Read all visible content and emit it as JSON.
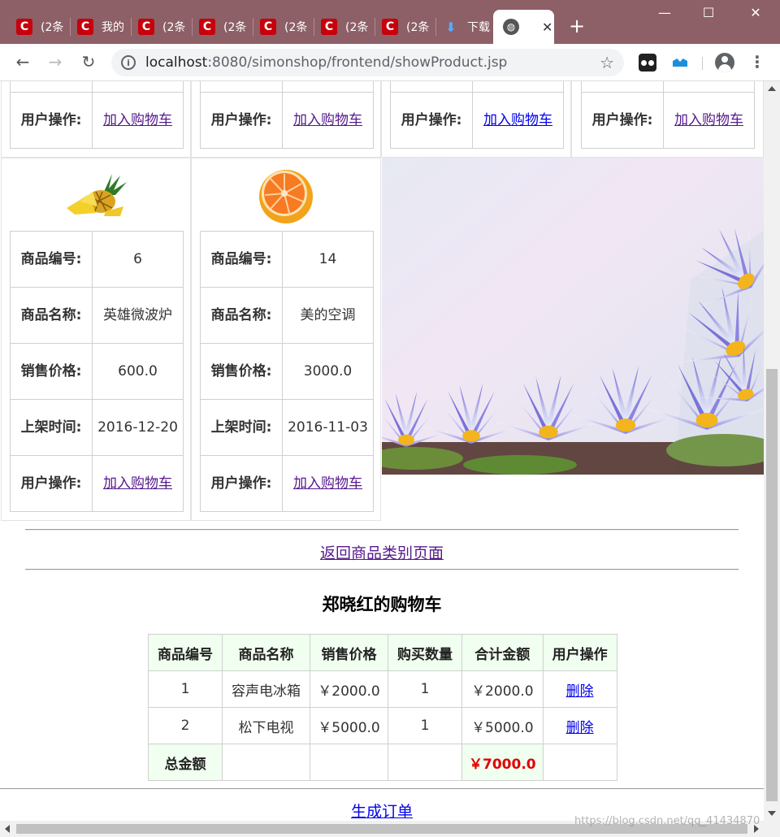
{
  "browser": {
    "tabs": [
      {
        "icon": "csdn-icon",
        "label": "(2条"
      },
      {
        "icon": "csdn-icon",
        "label": "我的"
      },
      {
        "icon": "csdn-icon",
        "label": "(2条"
      },
      {
        "icon": "csdn-icon",
        "label": "(2条"
      },
      {
        "icon": "csdn-icon",
        "label": "(2条"
      },
      {
        "icon": "csdn-icon",
        "label": "(2条"
      },
      {
        "icon": "csdn-icon",
        "label": "(2条"
      },
      {
        "icon": "download-icon",
        "label": "下载"
      }
    ],
    "active_tab": {
      "icon": "globe-icon",
      "close": "✕"
    },
    "new_tab": "+",
    "url_host": "localhost",
    "url_path": ":8080/simonshop/frontend/showProduct.jsp",
    "window": {
      "minimize": "—",
      "maximize": "☐",
      "close": "✕"
    }
  },
  "labels": {
    "id": "商品编号:",
    "name": "商品名称:",
    "price": "销售价格:",
    "date": "上架时间:",
    "action": "用户操作:",
    "add_cart": "加入购物车"
  },
  "top_row_cards": [
    {
      "action_label": "用户操作:",
      "link": "加入购物车"
    },
    {
      "action_label": "用户操作:",
      "link": "加入购物车"
    },
    {
      "action_label": "用户操作:",
      "link": "加入购物车"
    },
    {
      "action_label": "用户操作:",
      "link": "加入购物车"
    }
  ],
  "products": [
    {
      "image": "pineapple",
      "id": "6",
      "name": "英雄微波炉",
      "price": "600.0",
      "date": "2016-12-20"
    },
    {
      "image": "orange",
      "id": "14",
      "name": "美的空调",
      "price": "3000.0",
      "date": "2016-11-03"
    }
  ],
  "back_link": "返回商品类别页面",
  "cart": {
    "title": "郑晓红的购物车",
    "headers": [
      "商品编号",
      "商品名称",
      "销售价格",
      "购买数量",
      "合计金额",
      "用户操作"
    ],
    "rows": [
      {
        "id": "1",
        "name": "容声电冰箱",
        "price": "￥2000.0",
        "qty": "1",
        "subtotal": "￥2000.0",
        "action": "删除"
      },
      {
        "id": "2",
        "name": "松下电视",
        "price": "￥5000.0",
        "qty": "1",
        "subtotal": "￥5000.0",
        "action": "删除"
      }
    ],
    "total_label": "总金额",
    "total_value": "￥7000.0"
  },
  "order_link": "生成订单",
  "watermark": "https://blog.csdn.net/qq_41434870",
  "colors": {
    "tabbar": "#8d5f66",
    "header_bg": "#f0fff0",
    "total_red": "#e00000",
    "link_visited": "#551a8b",
    "link": "#0000ee"
  }
}
